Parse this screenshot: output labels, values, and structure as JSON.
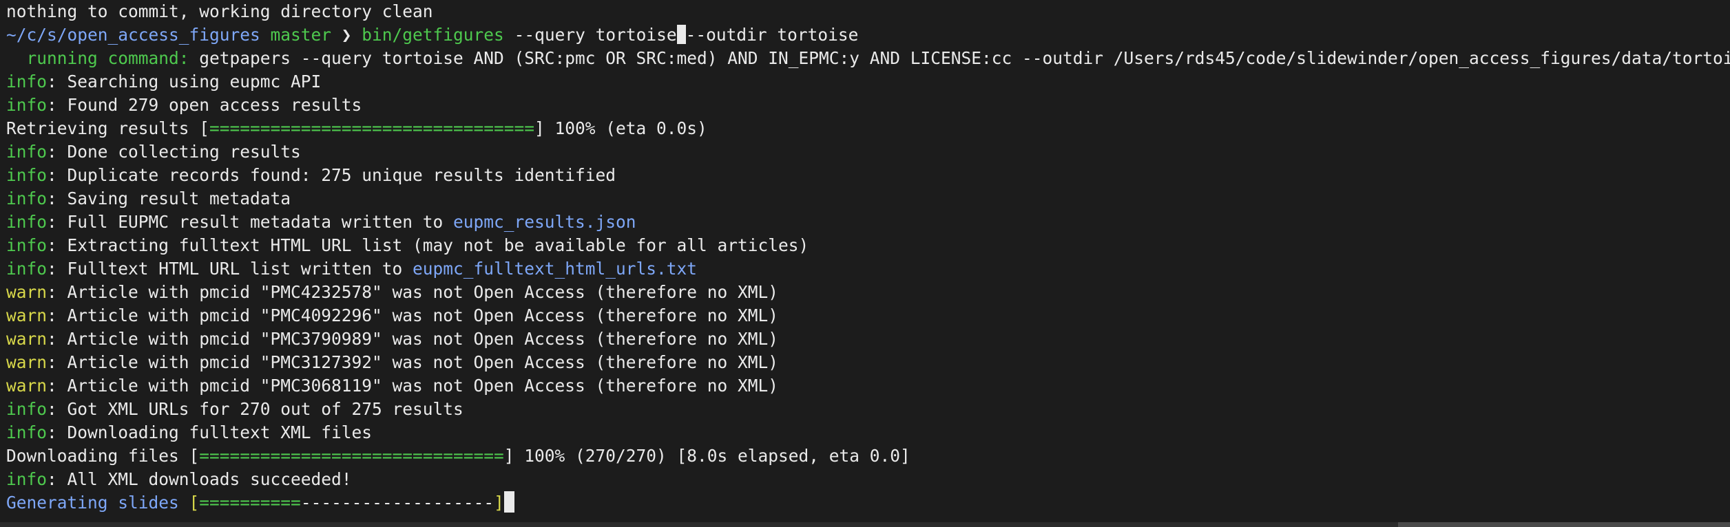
{
  "terminal": {
    "line01": "nothing to commit, working directory clean",
    "prompt": {
      "path": "~/c/s/open_access_figures",
      "branch": " master",
      "arrow": " ❯ ",
      "command": "bin/getfigures",
      "args_before_cursor": " --query tortoise",
      "args_after_cursor": "--outdir tortoise"
    },
    "running": {
      "label": "  running command:",
      "text": " getpapers --query tortoise AND (SRC:pmc OR SRC:med) AND IN_EPMC:y AND LICENSE:cc --outdir /Users/rds45/code/slidewinder/open_access_figures/data/tortoise --xml"
    },
    "info_label": "info",
    "warn_label": "warn",
    "info03": ": Searching using eupmc API",
    "info04": ": Found 279 open access results",
    "retrieving": {
      "label": "Retrieving results [",
      "bar": "================================",
      "suffix": "] 100% (eta 0.0s)"
    },
    "info06": ": Done collecting results",
    "info07": ": Duplicate records found: 275 unique results identified",
    "info08": ": Saving result metadata",
    "info09_text": ": Full EUPMC result metadata written to ",
    "info09_file": "eupmc_results.json",
    "info10": ": Extracting fulltext HTML URL list (may not be available for all articles)",
    "info11_text": ": Fulltext HTML URL list written to ",
    "info11_file": "eupmc_fulltext_html_urls.txt",
    "warn12": ": Article with pmcid \"PMC4232578\" was not Open Access (therefore no XML)",
    "warn13": ": Article with pmcid \"PMC4092296\" was not Open Access (therefore no XML)",
    "warn14": ": Article with pmcid \"PMC3790989\" was not Open Access (therefore no XML)",
    "warn15": ": Article with pmcid \"PMC3127392\" was not Open Access (therefore no XML)",
    "warn16": ": Article with pmcid \"PMC3068119\" was not Open Access (therefore no XML)",
    "info17": ": Got XML URLs for 270 out of 275 results",
    "info18": ": Downloading fulltext XML files",
    "downloading": {
      "label": "Downloading files [",
      "bar": "==============================",
      "suffix": "] 100% (270/270) [8.0s elapsed, eta 0.0]"
    },
    "info20": ": All XML downloads succeeded!",
    "generating": {
      "label": "Generating slides",
      "space": " ",
      "open": "[",
      "bar_filled": "==========",
      "bar_empty": "-------------------",
      "close": "]"
    }
  },
  "colors": {
    "background": "#1c1c1c",
    "text": "#eaeaea",
    "info": "#4ec94e",
    "warn": "#d8d84a",
    "path": "#7ea7f7"
  }
}
